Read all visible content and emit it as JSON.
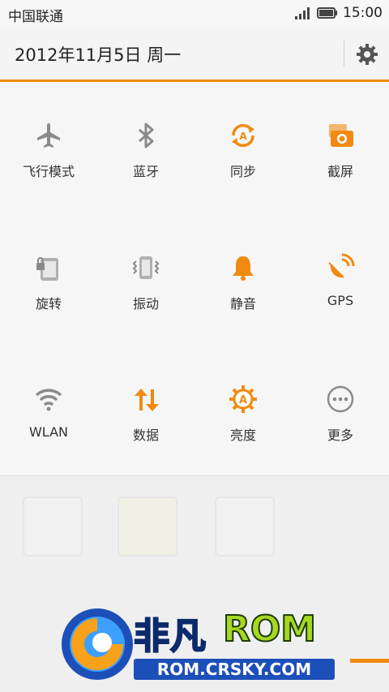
{
  "status_bar": {
    "carrier": "中国联通",
    "time": "15:00"
  },
  "header": {
    "date": "2012年11月5日 周一"
  },
  "toggles": [
    {
      "label": "飞行模式",
      "icon": "airplane-icon",
      "active": false
    },
    {
      "label": "蓝牙",
      "icon": "bluetooth-icon",
      "active": false
    },
    {
      "label": "同步",
      "icon": "sync-icon",
      "active": true
    },
    {
      "label": "截屏",
      "icon": "screenshot-icon",
      "active": true
    },
    {
      "label": "旋转",
      "icon": "rotation-icon",
      "active": false
    },
    {
      "label": "振动",
      "icon": "vibrate-icon",
      "active": false
    },
    {
      "label": "静音",
      "icon": "bell-icon",
      "active": true
    },
    {
      "label": "GPS",
      "icon": "gps-icon",
      "active": true
    },
    {
      "label": "WLAN",
      "icon": "wifi-icon",
      "active": false
    },
    {
      "label": "数据",
      "icon": "data-icon",
      "active": true
    },
    {
      "label": "亮度",
      "icon": "brightness-icon",
      "active": true
    },
    {
      "label": "更多",
      "icon": "more-icon",
      "active": false
    }
  ],
  "watermark": {
    "brand": "非凡",
    "rom": "ROM",
    "url": "ROM.CRSKY.COM"
  },
  "colors": {
    "accent": "#f08a10",
    "inactive_icon": "#8a8a8a"
  }
}
